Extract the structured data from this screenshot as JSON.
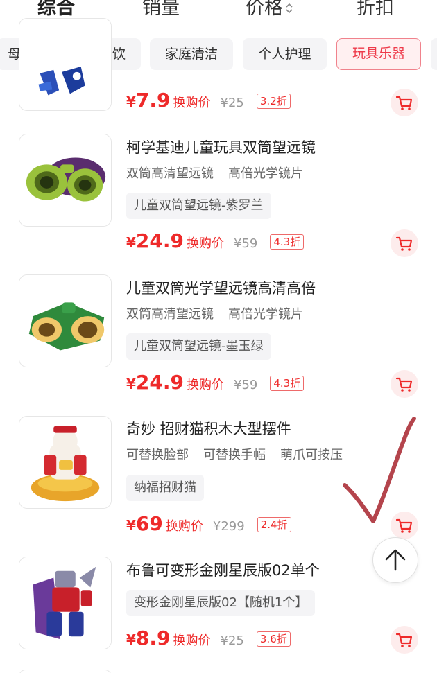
{
  "sort_tabs": [
    {
      "label": "综合",
      "active": true
    },
    {
      "label": "销量",
      "active": false
    },
    {
      "label": "价格",
      "active": false
    },
    {
      "label": "折扣",
      "active": false
    }
  ],
  "sort_arrows": "⌃⌄",
  "categories": [
    {
      "label": "母婴",
      "active": false
    },
    {
      "label": "零食乳饮",
      "active": false
    },
    {
      "label": "家庭清洁",
      "active": false
    },
    {
      "label": "个人护理",
      "active": false
    },
    {
      "label": "玩具乐器",
      "active": true
    }
  ],
  "currency": "¥",
  "price_label": "换购价",
  "products": [
    {
      "title": "",
      "tags": [],
      "variant": "",
      "price": "7.9",
      "original_price": "¥25",
      "discount": "3.2折"
    },
    {
      "title": "柯学基迪儿童玩具双筒望远镜",
      "tags": [
        "双筒高清望远镜",
        "高倍光学镜片"
      ],
      "variant": "儿童双筒望远镜-紫罗兰",
      "price": "24.9",
      "original_price": "¥59",
      "discount": "4.3折"
    },
    {
      "title": "儿童双筒光学望远镜高清高倍",
      "tags": [
        "双筒高清望远镜",
        "高倍光学镜片"
      ],
      "variant": "儿童双筒望远镜-墨玉绿",
      "price": "24.9",
      "original_price": "¥59",
      "discount": "4.3折"
    },
    {
      "title": "奇妙 招财猫积木大型摆件",
      "tags": [
        "可替换脸部",
        "可替换手幅",
        "萌爪可按压"
      ],
      "variant": "纳福招财猫",
      "price": "69",
      "original_price": "¥299",
      "discount": "2.4折"
    },
    {
      "title": "布鲁可变形金刚星辰版02单个",
      "tags": [],
      "variant": "变形金刚星辰版02【随机1个】",
      "price": "8.9",
      "original_price": "¥25",
      "discount": "3.6折"
    }
  ],
  "icons": {
    "cart": "cart-icon",
    "back_to_top": "arrow-up-icon",
    "annotation": "checkmark-icon"
  },
  "colors": {
    "accent": "#ee2a2a",
    "chip_active_bg": "#fff0f1",
    "chip_bg": "#f4f4f6",
    "checkmark": "#b4444c"
  }
}
